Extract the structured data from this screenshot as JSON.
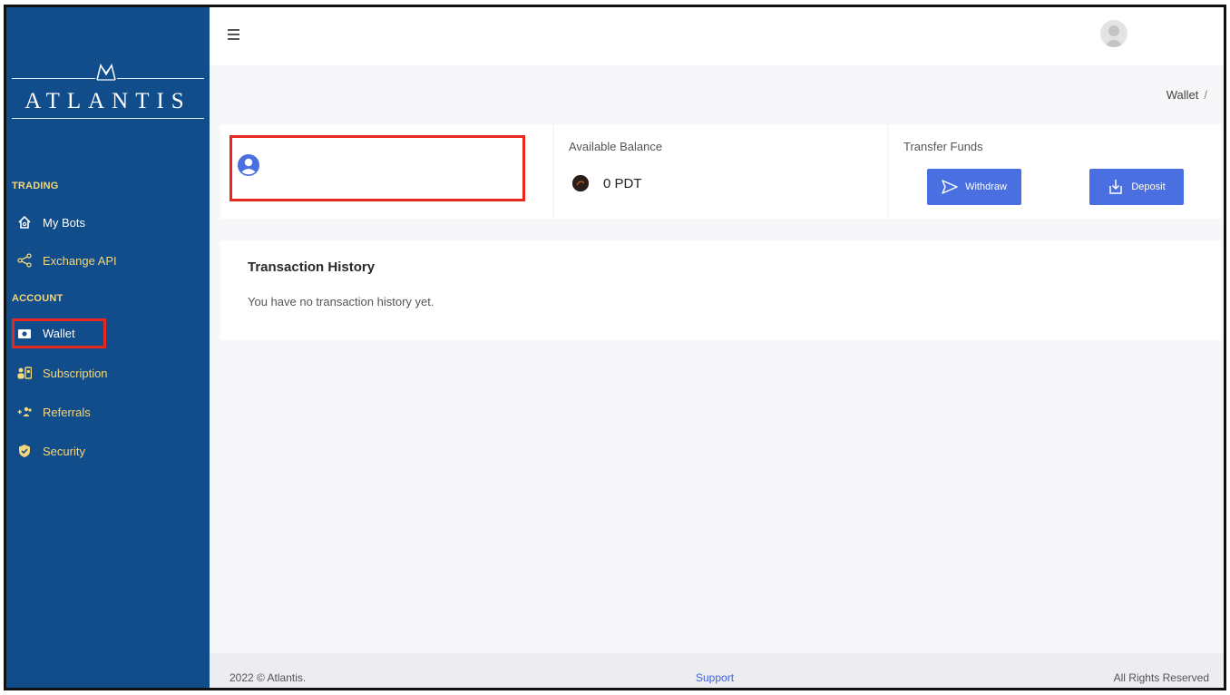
{
  "brand": {
    "name": "ATLANTIS"
  },
  "sidebar": {
    "sections": [
      {
        "heading": "TRADING"
      },
      {
        "heading": "ACCOUNT"
      }
    ],
    "items": [
      {
        "label": "My Bots",
        "icon": "home-icon"
      },
      {
        "label": "Exchange API",
        "icon": "share-icon"
      },
      {
        "label": "Wallet",
        "icon": "wallet-icon",
        "active": true
      },
      {
        "label": "Subscription",
        "icon": "subscription-icon"
      },
      {
        "label": "Referrals",
        "icon": "add-users-icon"
      },
      {
        "label": "Security",
        "icon": "shield-icon"
      }
    ]
  },
  "breadcrumb": {
    "current": "Wallet",
    "separator": "/"
  },
  "balance": {
    "label": "Available Balance",
    "value": "0 PDT"
  },
  "transfer": {
    "label": "Transfer Funds",
    "withdraw_label": "Withdraw",
    "deposit_label": "Deposit"
  },
  "transactions": {
    "title": "Transaction History",
    "empty_message": "You have no transaction history yet."
  },
  "footer": {
    "copyright": "2022 © Atlantis.",
    "support": "Support",
    "rights": "All Rights Reserved"
  },
  "colors": {
    "sidebar": "#114d8a",
    "accent": "#4a6fe0",
    "gold": "#f5d67a",
    "highlight": "#e8281c"
  }
}
